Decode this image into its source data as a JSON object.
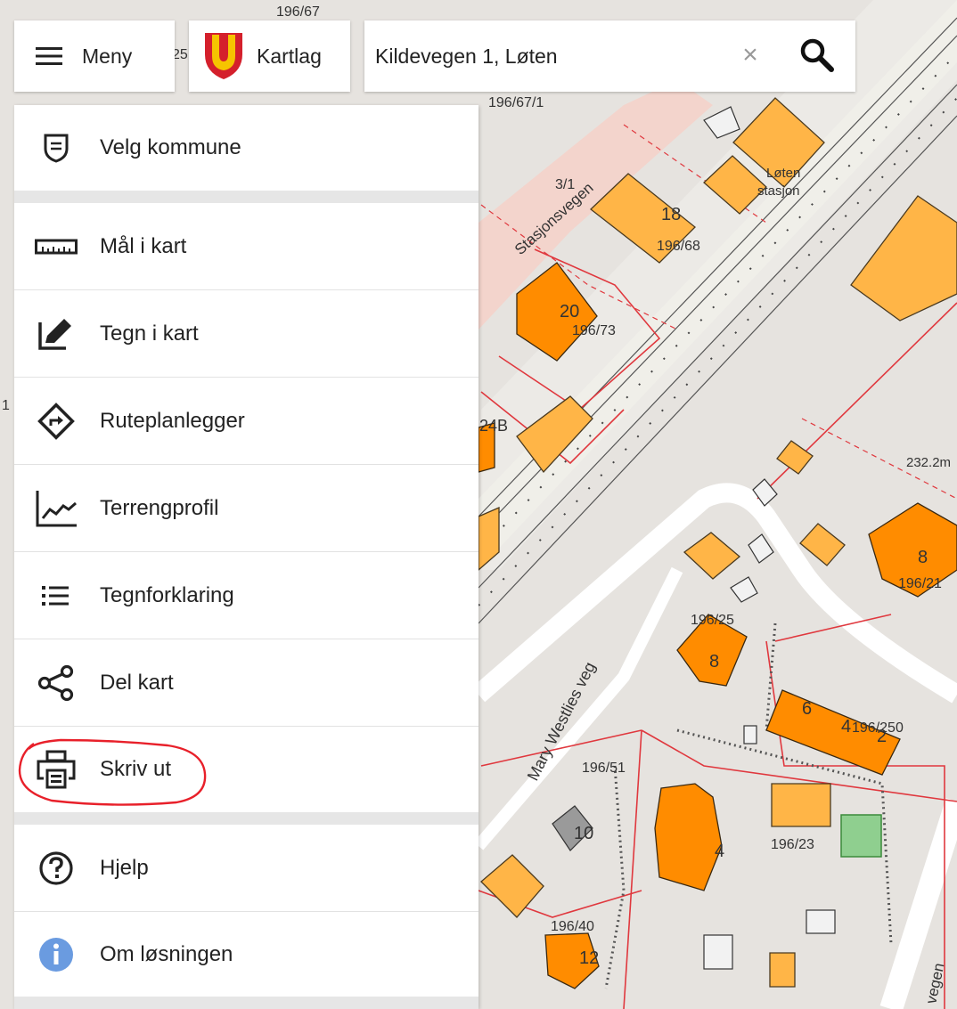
{
  "header": {
    "menu_label": "Meny",
    "layers_label": "Kartlag",
    "search": {
      "value": "Kildevegen 1, Løten",
      "clear_symbol": "×"
    }
  },
  "menu": {
    "select_municipality": "Velg kommune",
    "measure": "Mål i kart",
    "draw": "Tegn i kart",
    "route_planner": "Ruteplanlegger",
    "terrain_profile": "Terrengprofil",
    "legend": "Tegnforklaring",
    "share_map": "Del kart",
    "print": "Skriv ut",
    "help": "Hjelp",
    "about": "Om løsningen"
  },
  "map": {
    "labels": {
      "l1": "196/67",
      "l2": "196/67/1",
      "l3": "3/1",
      "l4": "Stasjonsvegen",
      "l5": "18",
      "l6": "196/68",
      "l7": "Løten",
      "l8": "stasjon",
      "l9": "20",
      "l10": "196/73",
      "l11": "24B",
      "l12": "232.2m",
      "l13": "8",
      "l14": "196/21",
      "l15": "196/25",
      "l16": "8",
      "l17": "Mary Westlies veg",
      "l18": "6",
      "l19": "4",
      "l20": "196/250",
      "l21": "2",
      "l22": "196/51",
      "l23": "10",
      "l24": "4",
      "l25": "196/23",
      "l26": "196/40",
      "l27": "12",
      "l28": "vegen",
      "l29": "25",
      "l30": "1"
    }
  },
  "colors": {
    "building_orange": "#ff8c00",
    "building_light": "#ffb547",
    "road": "#ffffff",
    "parcel_border": "#e0383e",
    "annotation": "#e8202a",
    "info_blue": "#6a9be0",
    "logo_red": "#d4202c",
    "logo_yellow": "#f6c400"
  }
}
